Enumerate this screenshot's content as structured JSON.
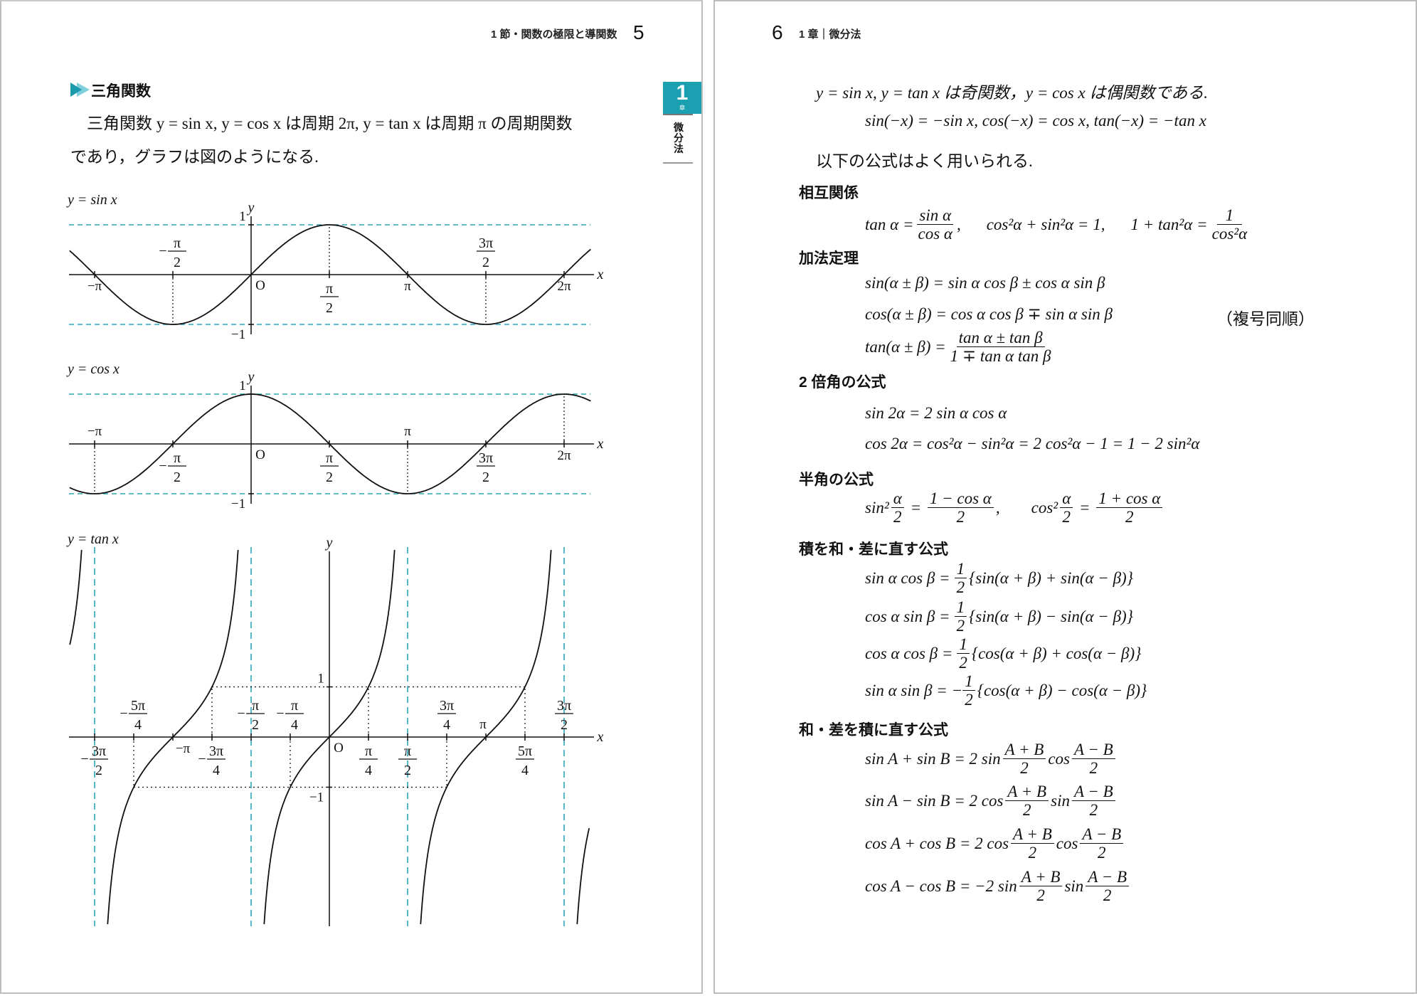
{
  "colors": {
    "accent": "#1aa0b0",
    "accent_light": "#7fcfdc",
    "dash": "#2aa6b5",
    "border": "#bdbdbd"
  },
  "left_page": {
    "header": {
      "section": "1 節・関数の極限と導関数",
      "page_number": "5"
    },
    "chapter_tab": {
      "number": "1",
      "sub": "章",
      "label": "微分法"
    },
    "section_icon": "double-triangle-icon",
    "section_title": "三角関数",
    "paragraph": [
      "三角関数 y = sin x, y = cos x は周期 2π,  y = tan x は周期 π の周期関数",
      "であり，グラフは図のようになる."
    ]
  },
  "right_page": {
    "header": {
      "page_number": "6",
      "chapter": "1 章｜微分法"
    },
    "intro": "y = sin x, y = tan x は奇関数，y = cos x は偶関数である.",
    "parity": "sin(−x) = −sin x,    cos(−x) = cos x,    tan(−x) = −tan x",
    "intro2": "以下の公式はよく用いられる.",
    "sections": {
      "mutual": {
        "title": "相互関係",
        "f1_lhs": "tan α =",
        "f1_num": "sin α",
        "f1_den": "cos α",
        "f1_tail": ",",
        "f2": "cos²α + sin²α = 1,",
        "f3_lhs": "1 + tan²α =",
        "f3_num": "1",
        "f3_den": "cos²α"
      },
      "addition": {
        "title": "加法定理",
        "sin": "sin(α ± β) = sin α cos β ± cos α sin β",
        "cos": "cos(α ± β) = cos α cos β ∓ sin α sin β",
        "note": "（複号同順）",
        "tan_lhs": "tan(α ± β) =",
        "tan_num": "tan α ± tan β",
        "tan_den": "1 ∓ tan α tan β"
      },
      "double": {
        "title": "2 倍角の公式",
        "sin": "sin 2α  = 2 sin α cos α",
        "cos": "cos 2α  = cos²α − sin²α = 2 cos²α − 1 = 1 − 2 sin²α"
      },
      "half": {
        "title": "半角の公式",
        "s_lhs": "sin²",
        "s_lnum": "α",
        "s_lden": "2",
        "s_eq": " = ",
        "s_num": "1 − cos α",
        "s_den": "2",
        "s_tail": ",",
        "c_lhs": "cos²",
        "c_lnum": "α",
        "c_lden": "2",
        "c_eq": " = ",
        "c_num": "1 + cos α",
        "c_den": "2"
      },
      "product_to_sum": {
        "title": "積を和・差に直す公式",
        "rows": [
          {
            "lhs": "sin α cos β =",
            "sign": "",
            "num": "1",
            "den": "2",
            "rhs": "{sin(α + β) + sin(α − β)}"
          },
          {
            "lhs": "cos α sin β =",
            "sign": "",
            "num": "1",
            "den": "2",
            "rhs": "{sin(α + β) − sin(α − β)}"
          },
          {
            "lhs": "cos α cos β =",
            "sign": "",
            "num": "1",
            "den": "2",
            "rhs": "{cos(α + β) + cos(α − β)}"
          },
          {
            "lhs": "sin α sin β  =",
            "sign": "−",
            "num": "1",
            "den": "2",
            "rhs": "{cos(α + β) − cos(α − β)}"
          }
        ]
      },
      "sum_to_product": {
        "title": "和・差を積に直す公式",
        "rows": [
          {
            "lhs": "sin A + sin B  = 2 sin",
            "n1": "A + B",
            "d1": "2",
            "mid": "cos",
            "n2": "A − B",
            "d2": "2"
          },
          {
            "lhs": "sin A − sin B  = 2 cos",
            "n1": "A + B",
            "d1": "2",
            "mid": "sin",
            "n2": "A − B",
            "d2": "2"
          },
          {
            "lhs": "cos A + cos B = 2 cos",
            "n1": "A + B",
            "d1": "2",
            "mid": "cos",
            "n2": "A − B",
            "d2": "2"
          },
          {
            "lhs": "cos A − cos B = −2 sin",
            "n1": "A + B",
            "d1": "2",
            "mid": "sin",
            "n2": "A − B",
            "d2": "2"
          }
        ]
      }
    }
  },
  "chart_data": [
    {
      "type": "line",
      "title": "y = sin x",
      "function": "sin",
      "xlabel": "x",
      "ylabel": "y",
      "origin_label": "O",
      "xlim_pi": [
        -1.16,
        2.17
      ],
      "ylim": [
        -1,
        1
      ],
      "asymptotes_dashed_y": [
        1,
        -1
      ],
      "ytick_labels": [
        "1",
        "−1"
      ],
      "x_ticks": [
        {
          "value_pi": -1,
          "label": "−π",
          "pos": "below"
        },
        {
          "value_pi": -0.5,
          "label": "−π/2",
          "pos": "above",
          "guide": true
        },
        {
          "value_pi": 0.5,
          "label": "π/2",
          "pos": "below",
          "guide": true
        },
        {
          "value_pi": 1,
          "label": "π",
          "pos": "below"
        },
        {
          "value_pi": 1.5,
          "label": "3π/2",
          "pos": "above",
          "guide": true
        },
        {
          "value_pi": 2,
          "label": "2π",
          "pos": "below"
        }
      ]
    },
    {
      "type": "line",
      "title": "y = cos x",
      "function": "cos",
      "xlabel": "x",
      "ylabel": "y",
      "origin_label": "O",
      "xlim_pi": [
        -1.16,
        2.17
      ],
      "ylim": [
        -1,
        1
      ],
      "asymptotes_dashed_y": [
        1,
        -1
      ],
      "ytick_labels": [
        "1",
        "−1"
      ],
      "x_ticks": [
        {
          "value_pi": -1,
          "label": "−π",
          "pos": "above",
          "guide": true
        },
        {
          "value_pi": -0.5,
          "label": "−π/2",
          "pos": "below"
        },
        {
          "value_pi": 0.5,
          "label": "π/2",
          "pos": "below"
        },
        {
          "value_pi": 1,
          "label": "π",
          "pos": "above",
          "guide": true
        },
        {
          "value_pi": 1.5,
          "label": "3π/2",
          "pos": "below"
        },
        {
          "value_pi": 2,
          "label": "2π",
          "pos": "below",
          "guide": true
        }
      ]
    },
    {
      "type": "line",
      "title": "y = tan x",
      "function": "tan",
      "xlabel": "x",
      "ylabel": "y",
      "origin_label": "O",
      "xlim_pi": [
        -1.65,
        1.65
      ],
      "ylim": [
        -3.8,
        3.8
      ],
      "asymptotes_dashed_x_pi": [
        -1.5,
        -0.5,
        0.5,
        1.5
      ],
      "ytick_labels": [
        "1",
        "−1"
      ],
      "x_ticks": [
        {
          "value_pi": -1.5,
          "label": "−3π/2",
          "pos": "below"
        },
        {
          "value_pi": -1.25,
          "label": "−5π/4",
          "pos": "above",
          "guide": -1
        },
        {
          "value_pi": -1,
          "label": "−π",
          "pos": "below-right"
        },
        {
          "value_pi": -0.75,
          "label": "−3π/4",
          "pos": "below",
          "guide": 1
        },
        {
          "value_pi": -0.5,
          "label": "−π/2",
          "pos": "above"
        },
        {
          "value_pi": -0.25,
          "label": "−π/4",
          "pos": "above",
          "guide": -1
        },
        {
          "value_pi": 0.25,
          "label": "π/4",
          "pos": "below",
          "guide": 1
        },
        {
          "value_pi": 0.5,
          "label": "π/2",
          "pos": "below"
        },
        {
          "value_pi": 0.75,
          "label": "3π/4",
          "pos": "above",
          "guide": -1
        },
        {
          "value_pi": 1,
          "label": "π",
          "pos": "above-left"
        },
        {
          "value_pi": 1.25,
          "label": "5π/4",
          "pos": "below",
          "guide": 1
        },
        {
          "value_pi": 1.5,
          "label": "3π/2",
          "pos": "above"
        }
      ]
    }
  ]
}
